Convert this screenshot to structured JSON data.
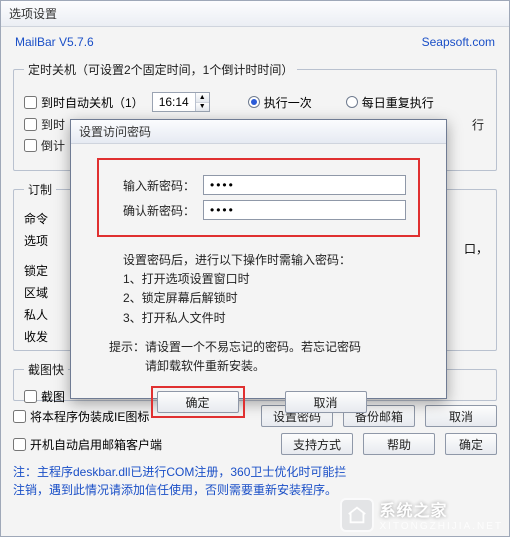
{
  "main": {
    "title": "选项设置",
    "brand": "MailBar V5.7.6",
    "site": "Seapsoft.com",
    "group_timer_legend": "定时关机（可设置2个固定时间，1个倒计时时间）",
    "chk_shutdown1": "到时自动关机（1）",
    "time1": "16:14",
    "radio_once": "执行一次",
    "radio_daily": "每日重复执行",
    "chk_shutdown2_partial": "到时",
    "chk_countdown_partial": "倒计",
    "chk_shutdown2_trail": "行",
    "group_sub_legend": "订制",
    "lbl_cmd": "命令",
    "lbl_opt": "选项",
    "lbl_lock": "锁定",
    "lbl_area": "区域",
    "lbl_priv": "私人",
    "lbl_recv": "收发",
    "trail_kou": "口，",
    "group_shot_legend": "截图快",
    "chk_shot": "截图",
    "chk_fake_ie": "将本程序伪装成IE图标",
    "chk_autostart": "开机自动启用邮箱客户端",
    "btn_setpw": "设置密码",
    "btn_backup": "备份邮箱",
    "btn_support": "支持方式",
    "btn_help": "帮助",
    "btn_cancel": "取消",
    "btn_confirm_partial": "确定",
    "note1": "注：主程序deskbar.dll已进行COM注册，360卫士优化时可能拦",
    "note2": "注销，遇到此情况请添加信任使用，否则需要重新安装程序。"
  },
  "modal": {
    "title": "设置访问密码",
    "lbl_new": "输入新密码：",
    "lbl_confirm": "确认新密码：",
    "pw_value": "••••",
    "info_head": "设置密码后，进行以下操作时需输入密码：",
    "info_1": "1、打开选项设置窗口时",
    "info_2": "2、锁定屏幕后解锁时",
    "info_3": "3、打开私人文件时",
    "hint1": "提示：请设置一个不易忘记的密码。若忘记密码",
    "hint2": "请卸载软件重新安装。",
    "btn_ok": "确定",
    "btn_cancel": "取消"
  },
  "watermark": {
    "name": "系统之家",
    "sub": "XITONGZHIJIA.NET"
  }
}
